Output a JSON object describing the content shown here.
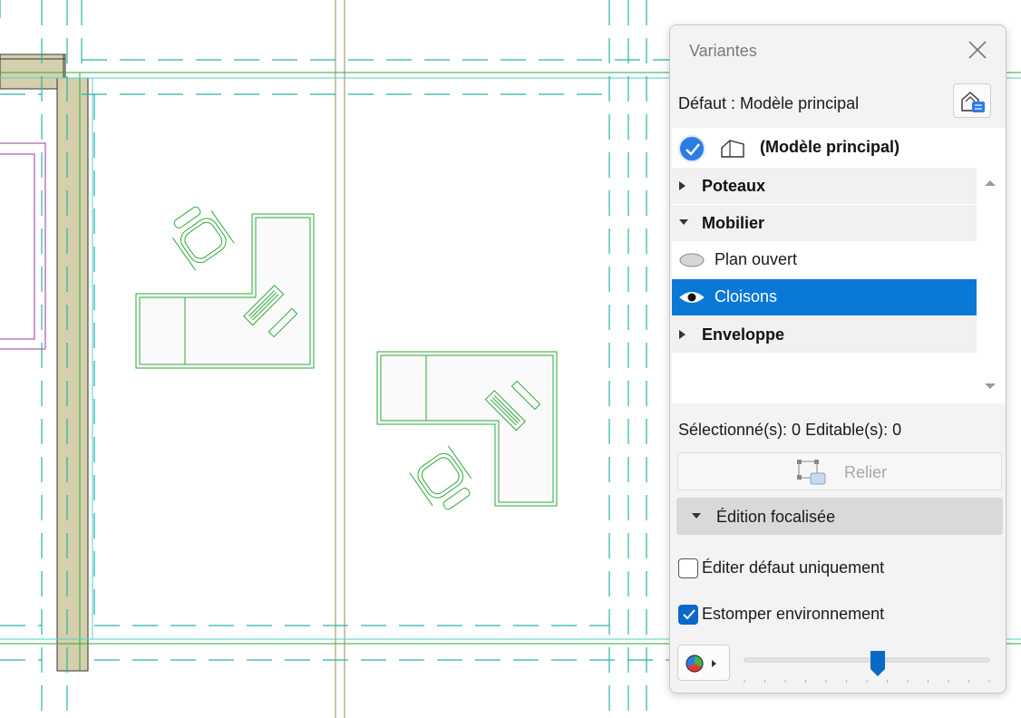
{
  "panel": {
    "title": "Variantes",
    "default_label": "Défaut : Modèle principal",
    "main_model_label": "(Modèle principal)",
    "groups": [
      {
        "label": "Poteaux",
        "expanded": false
      },
      {
        "label": "Mobilier",
        "expanded": true,
        "items": [
          {
            "label": "Plan ouvert",
            "visible": false,
            "selected": false
          },
          {
            "label": "Cloisons",
            "visible": true,
            "selected": true
          }
        ]
      },
      {
        "label": "Enveloppe",
        "expanded": false
      }
    ],
    "status_text": "Sélectionné(s): 0 Editable(s): 0",
    "relier_label": "Relier",
    "focused_edit_label": "Édition focalisée",
    "edit_default_only": {
      "label": "Éditer défaut uniquement",
      "checked": false
    },
    "fade_environment": {
      "label": "Estomper environnement",
      "checked": true
    },
    "fade_level": 0.5
  },
  "colors": {
    "wall_fill": "#d6cfac",
    "furniture_line": "#2eaa3a",
    "grid_dashed": "#27b3a6",
    "selection": "#0a78d7",
    "checkbox_accent": "#0a68c8"
  }
}
